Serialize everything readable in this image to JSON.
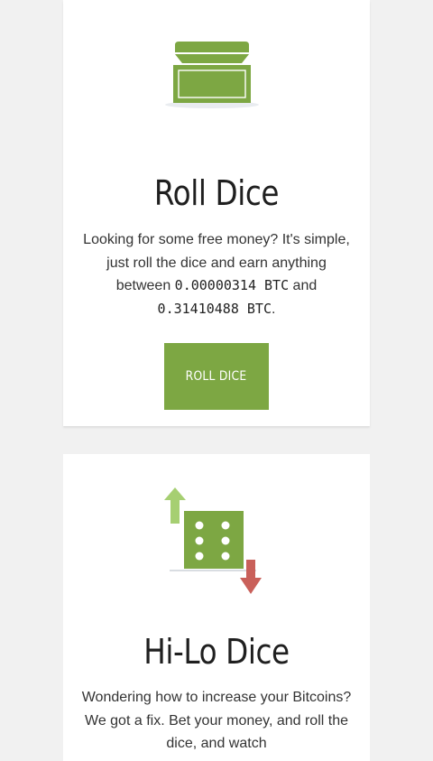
{
  "colors": {
    "accent": "#7da743",
    "up_arrow": "#a6cf72",
    "down_arrow": "#c9605a",
    "background": "#f1f1f1",
    "card": "#ffffff"
  },
  "roll_dice": {
    "icon": "treasure-chest-icon",
    "title": "Roll Dice",
    "description_part1": "Looking for some free money? It's simple, just roll the dice and earn anything between ",
    "min_amount": "0.00000314 BTC",
    "description_part2": " and ",
    "max_amount": "0.31410488 BTC",
    "description_part3": ".",
    "button_label": "ROLL DICE"
  },
  "hilo_dice": {
    "icon": "hi-lo-dice-icon",
    "title": "Hi-Lo Dice",
    "description": "Wondering how to increase your Bitcoins? We got a fix. Bet your money, and roll the dice, and watch"
  }
}
